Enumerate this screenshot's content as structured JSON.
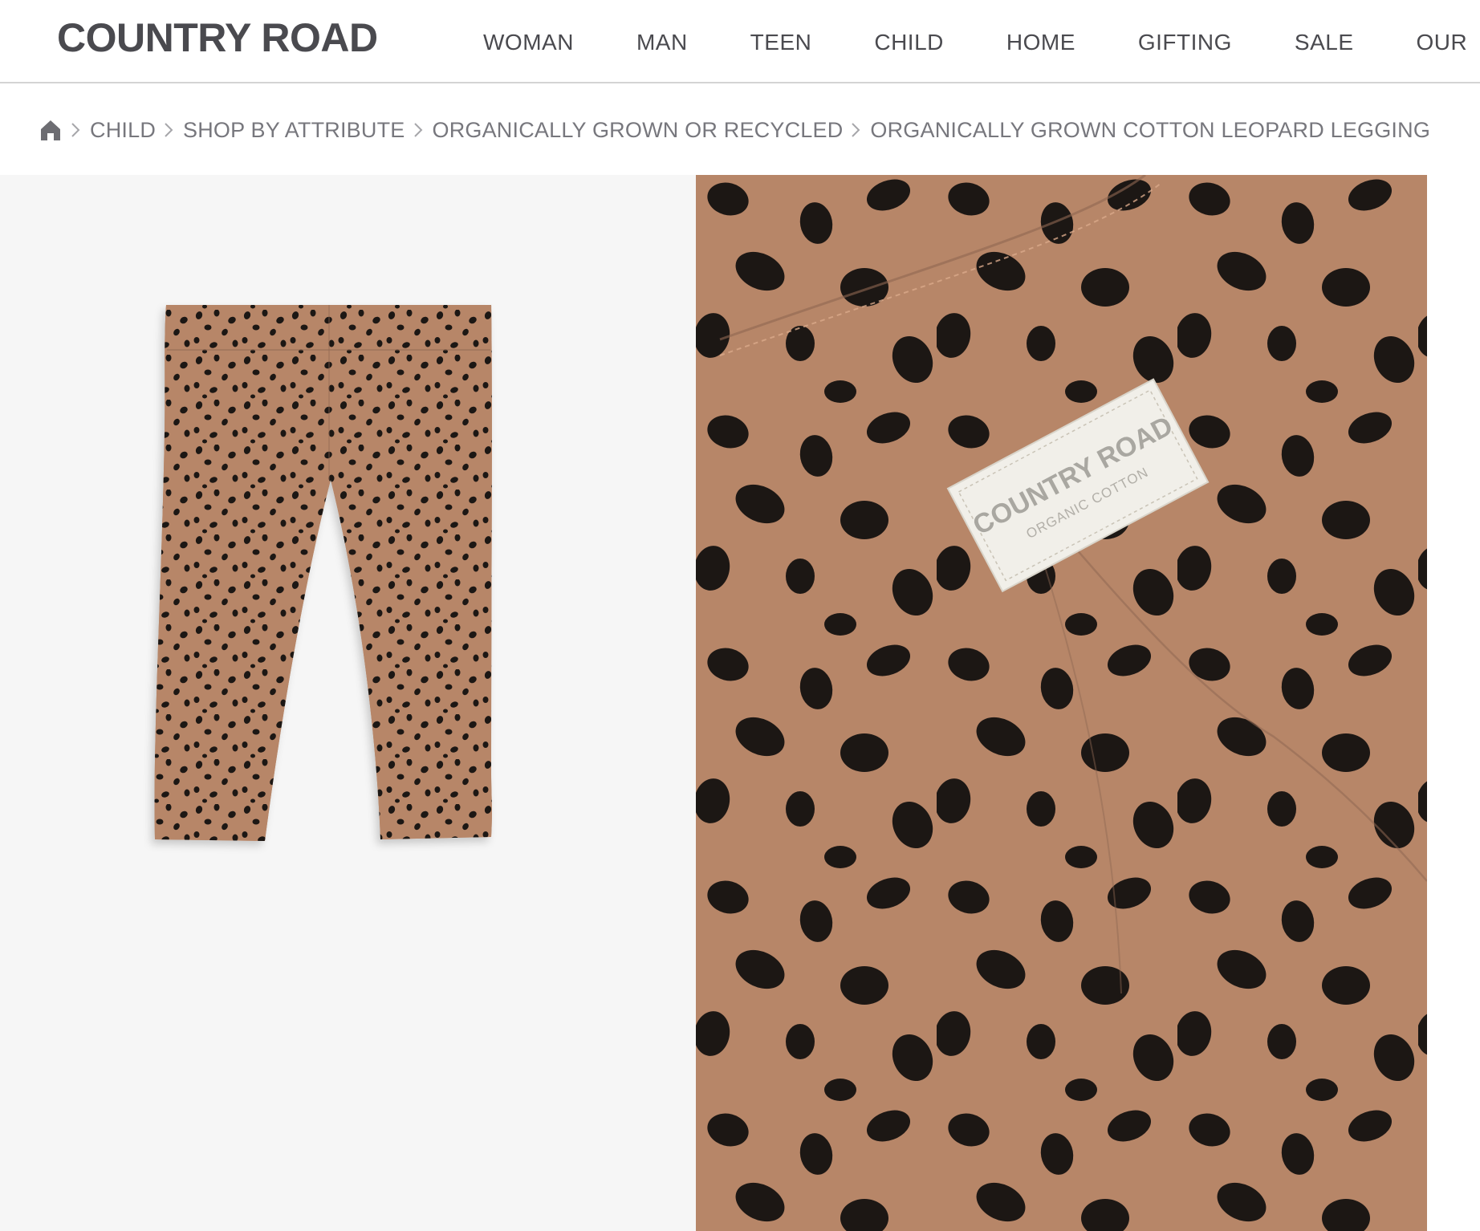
{
  "brand": {
    "logo": "COUNTRY ROAD"
  },
  "nav": {
    "items": [
      "WOMAN",
      "MAN",
      "TEEN",
      "CHILD",
      "HOME",
      "GIFTING",
      "SALE",
      "OUR"
    ]
  },
  "breadcrumb": {
    "home_icon": "home-icon",
    "items": [
      "CHILD",
      "SHOP BY ATTRIBUTE",
      "ORGANICALLY GROWN OR RECYCLED",
      "ORGANICALLY GROWN COTTON LEOPARD LEGGING"
    ]
  },
  "product": {
    "label_brand": "COUNTRY ROAD",
    "label_sub": "ORGANIC COTTON"
  },
  "colors": {
    "fabric": "#b78668",
    "spot": "#1c1714",
    "gallery_bg": "#f6f6f6",
    "label": "#f1efe9"
  }
}
